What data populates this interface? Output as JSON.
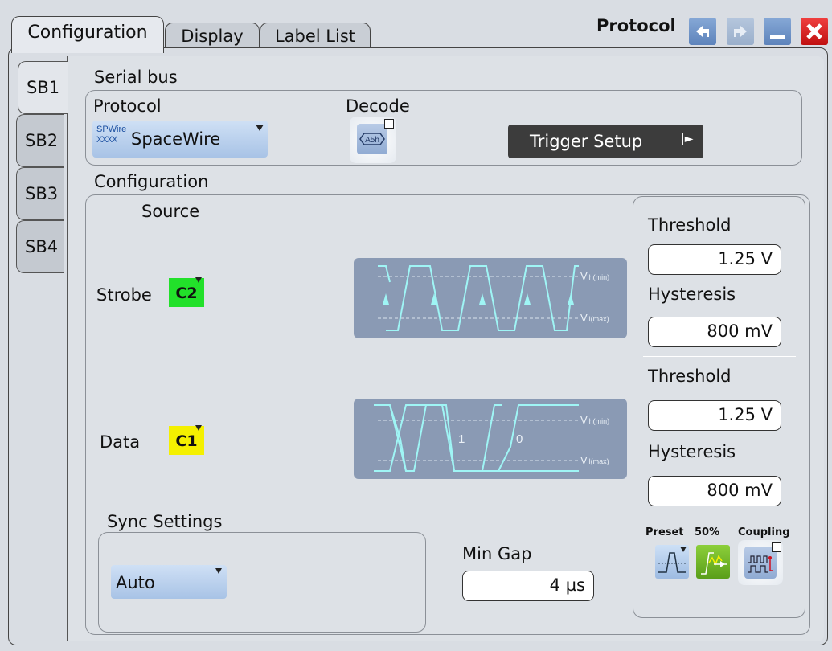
{
  "tabs": [
    "Configuration",
    "Display",
    "Label List"
  ],
  "window": {
    "title": "Protocol"
  },
  "side_tabs": [
    "SB1",
    "SB2",
    "SB3",
    "SB4"
  ],
  "serial_bus": {
    "group_label": "Serial bus",
    "protocol_label": "Protocol",
    "protocol_value": "SpaceWire",
    "protocol_icon_top": "SPWire",
    "protocol_icon_bottom": "XXXX",
    "decode_label": "Decode",
    "decode_icon_text": "A5h",
    "trigger_setup_label": "Trigger Setup"
  },
  "configuration": {
    "group_label": "Configuration",
    "source_label": "Source",
    "strobe": {
      "label": "Strobe",
      "channel": "C2",
      "channel_color": "#22e02a"
    },
    "data": {
      "label": "Data",
      "channel": "C1",
      "channel_color": "#f4f000",
      "bit_labels": [
        "1",
        "0"
      ]
    },
    "vih_label": "V",
    "vih_sub": "ih(min)",
    "vil_label": "V",
    "vil_sub": "il(max)",
    "strobe_threshold": {
      "label": "Threshold",
      "value": "1.25 V"
    },
    "strobe_hysteresis": {
      "label": "Hysteresis",
      "value": "800 mV"
    },
    "data_threshold": {
      "label": "Threshold",
      "value": "1.25 V"
    },
    "data_hysteresis": {
      "label": "Hysteresis",
      "value": "800 mV"
    },
    "preset_label": "Preset",
    "fifty_label": "50%",
    "coupling_label": "Coupling",
    "sync_settings": {
      "label": "Sync Settings",
      "value": "Auto"
    },
    "min_gap": {
      "label": "Min Gap",
      "value": "4 µs"
    }
  },
  "colors": {
    "diagram_bg": "#8a9ab4",
    "signal": "#9ff5f5",
    "trigger_button": "#3c3c3c"
  }
}
